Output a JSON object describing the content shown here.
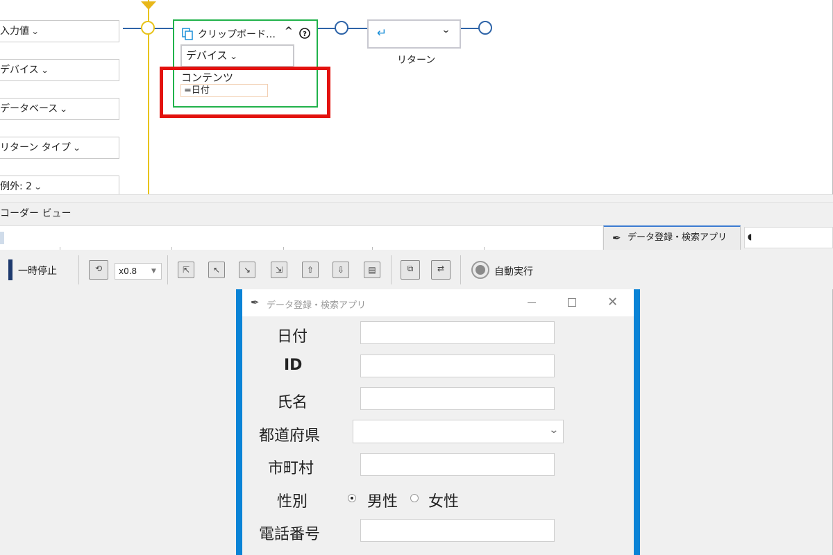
{
  "flow": {
    "props": [
      "入力値",
      "デバイス",
      "データベース",
      "リターン タイプ",
      "例外: 2"
    ],
    "clipboard_node": {
      "title": "クリップボード…",
      "device_label": "デバイス",
      "content_label": "コンテンツ",
      "content_value": "=日付"
    },
    "return_node": {
      "label": "リターン"
    }
  },
  "recorder": {
    "title": "コーダー ビュー",
    "tab_label": "データ登録・検索アプリ"
  },
  "toolbar": {
    "pause_label": "一時停止",
    "speed_value": "x0.8",
    "auto_run_label": "自動実行"
  },
  "app": {
    "title": "データ登録・検索アプリ",
    "fields": {
      "date": "日付",
      "id": "ID",
      "name": "氏名",
      "prefecture": "都道府県",
      "city": "市町村",
      "gender": "性別",
      "phone": "電話番号"
    },
    "gender_options": {
      "male": "男性",
      "female": "女性"
    },
    "gender_selected": "男性"
  },
  "colors": {
    "flow_line": "#2e64a8",
    "start_line": "#e8c31a",
    "node_active": "#20b24a",
    "highlight": "#e3120e",
    "window_border": "#0a83d6"
  }
}
